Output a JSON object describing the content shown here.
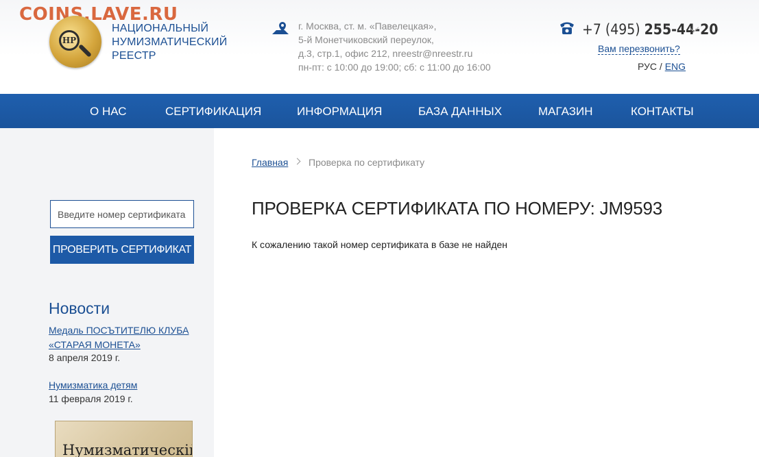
{
  "watermark": "COINS.LAVE.RU",
  "logo": {
    "monogram": "НР",
    "line1": "НАЦИОНАЛЬНЫЙ",
    "line2": "НУМИЗМАТИЧЕСКИЙ",
    "line3": "РЕЕСТР"
  },
  "address": {
    "line1": "г. Москва, ст. м. «Павелецкая»,",
    "line2": "5-й Монетчиковский переулок,",
    "line3": "д.3, стр.1, офис 212, nreestr@nreestr.ru",
    "line4": "пн-пт: с 10:00 до 19:00; сб: с 11:00 до 16:00"
  },
  "contact": {
    "phone_prefix": "+7 (495) ",
    "phone_number": "255-44-20",
    "callback": "Вам перезвонить?",
    "lang_ru": "РУС",
    "lang_sep": " / ",
    "lang_en": "ENG"
  },
  "nav": {
    "about": "О НАС",
    "certification": "СЕРТИФИКАЦИЯ",
    "information": "ИНФОРМАЦИЯ",
    "database": "БАЗА ДАННЫХ",
    "shop": "МАГАЗИН",
    "contacts": "КОНТАКТЫ"
  },
  "sidebar": {
    "cert_placeholder": "Введите номер сертификата",
    "cert_button": "ПРОВЕРИТЬ СЕРТИФИКАТ",
    "news_title": "Новости",
    "news": [
      {
        "title_line1": "Медаль ПОСЪТИТЕЛЮ КЛУБА",
        "title_line2": "«СТАРАЯ МОНЕТА»",
        "date": "8 апреля 2019 г."
      },
      {
        "title_line1": "Нумизматика детям",
        "date": "11 февраля 2019 г."
      }
    ],
    "book_text": "Нумизматическій"
  },
  "breadcrumb": {
    "home": "Главная",
    "current": "Проверка по сертификату"
  },
  "main": {
    "title": "ПРОВЕРКА СЕРТИФИКАТА ПО НОМЕРУ: JM9593",
    "result": "К сожалению такой номер сертификата в базе не найден"
  },
  "colors": {
    "brand_blue": "#1c5aa5",
    "link_blue": "#1b4f93",
    "watermark": "#d9683f",
    "sidebar_bg": "#f3f4f6"
  }
}
